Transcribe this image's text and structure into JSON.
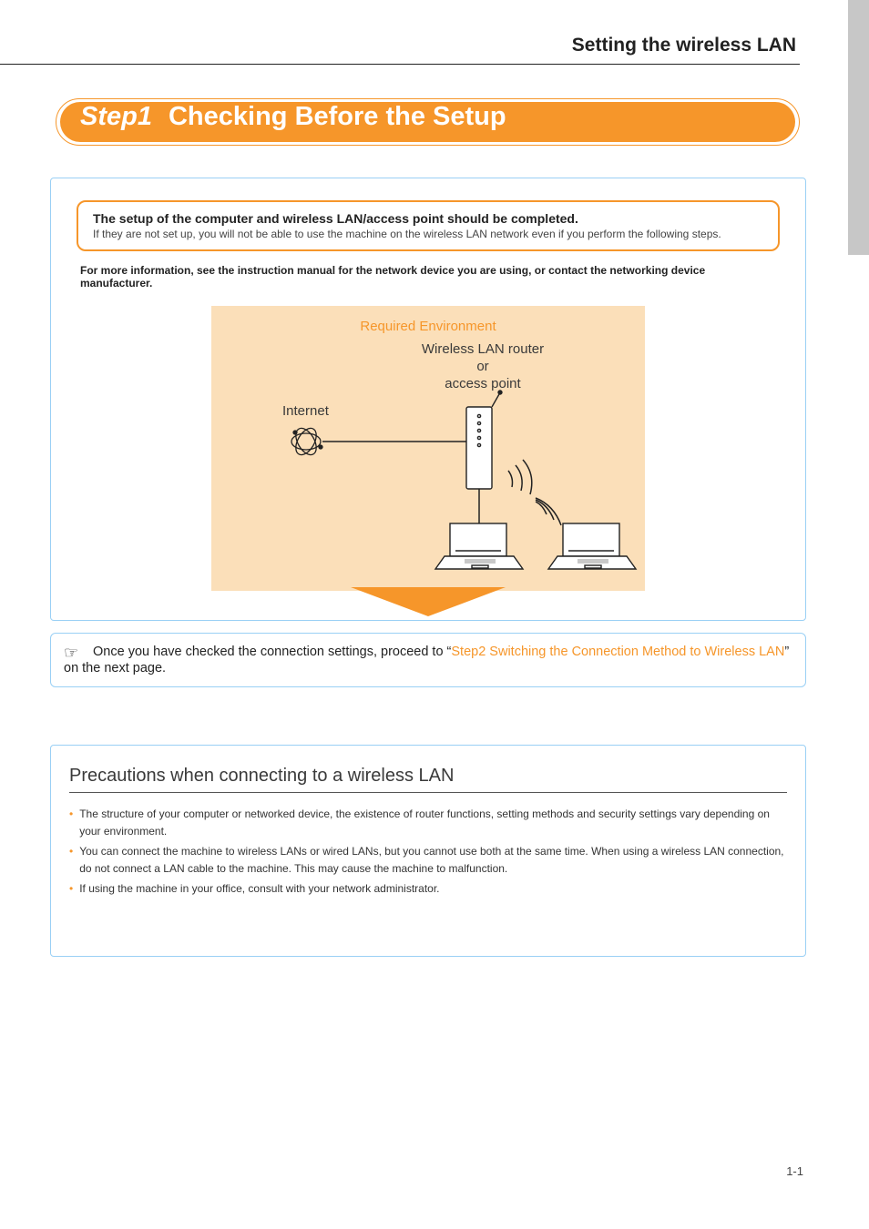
{
  "header": {
    "title": "Setting the wireless LAN"
  },
  "step_band": {
    "step": "Step1",
    "title": "Checking Before the Setup"
  },
  "setup_note": {
    "bold": "The setup of the computer and wireless LAN/access point should be completed.",
    "sub": "If they are not set up, you will not be able to use the machine on the wireless LAN network even if you perform the following steps."
  },
  "more_info": "For more information, see the instruction manual for the network device you are using, or contact the networking device manufacturer.",
  "diagram": {
    "title": "Required Environment",
    "router_label_line1": "Wireless LAN router",
    "router_label_line2": "or",
    "router_label_line3": "access point",
    "internet_label": "Internet"
  },
  "proceed": {
    "prefix": "Once you have checked the connection settings, proceed to “",
    "link": "Step2 Switching the Connection Method to Wireless LAN",
    "suffix": "” on the next page."
  },
  "precautions": {
    "title": "Precautions when connecting to a wireless LAN",
    "bullets": [
      "The structure of your computer or networked device, the existence of router functions, setting methods and security settings vary depending on your environment.",
      "You can connect the machine to wireless LANs or wired LANs, but you cannot use both at the same time. When using a wireless LAN connection, do not connect a LAN cable to the machine. This may cause the machine to malfunction.",
      "If using the machine in your office, consult with your network administrator."
    ]
  },
  "page_number": "1-1"
}
